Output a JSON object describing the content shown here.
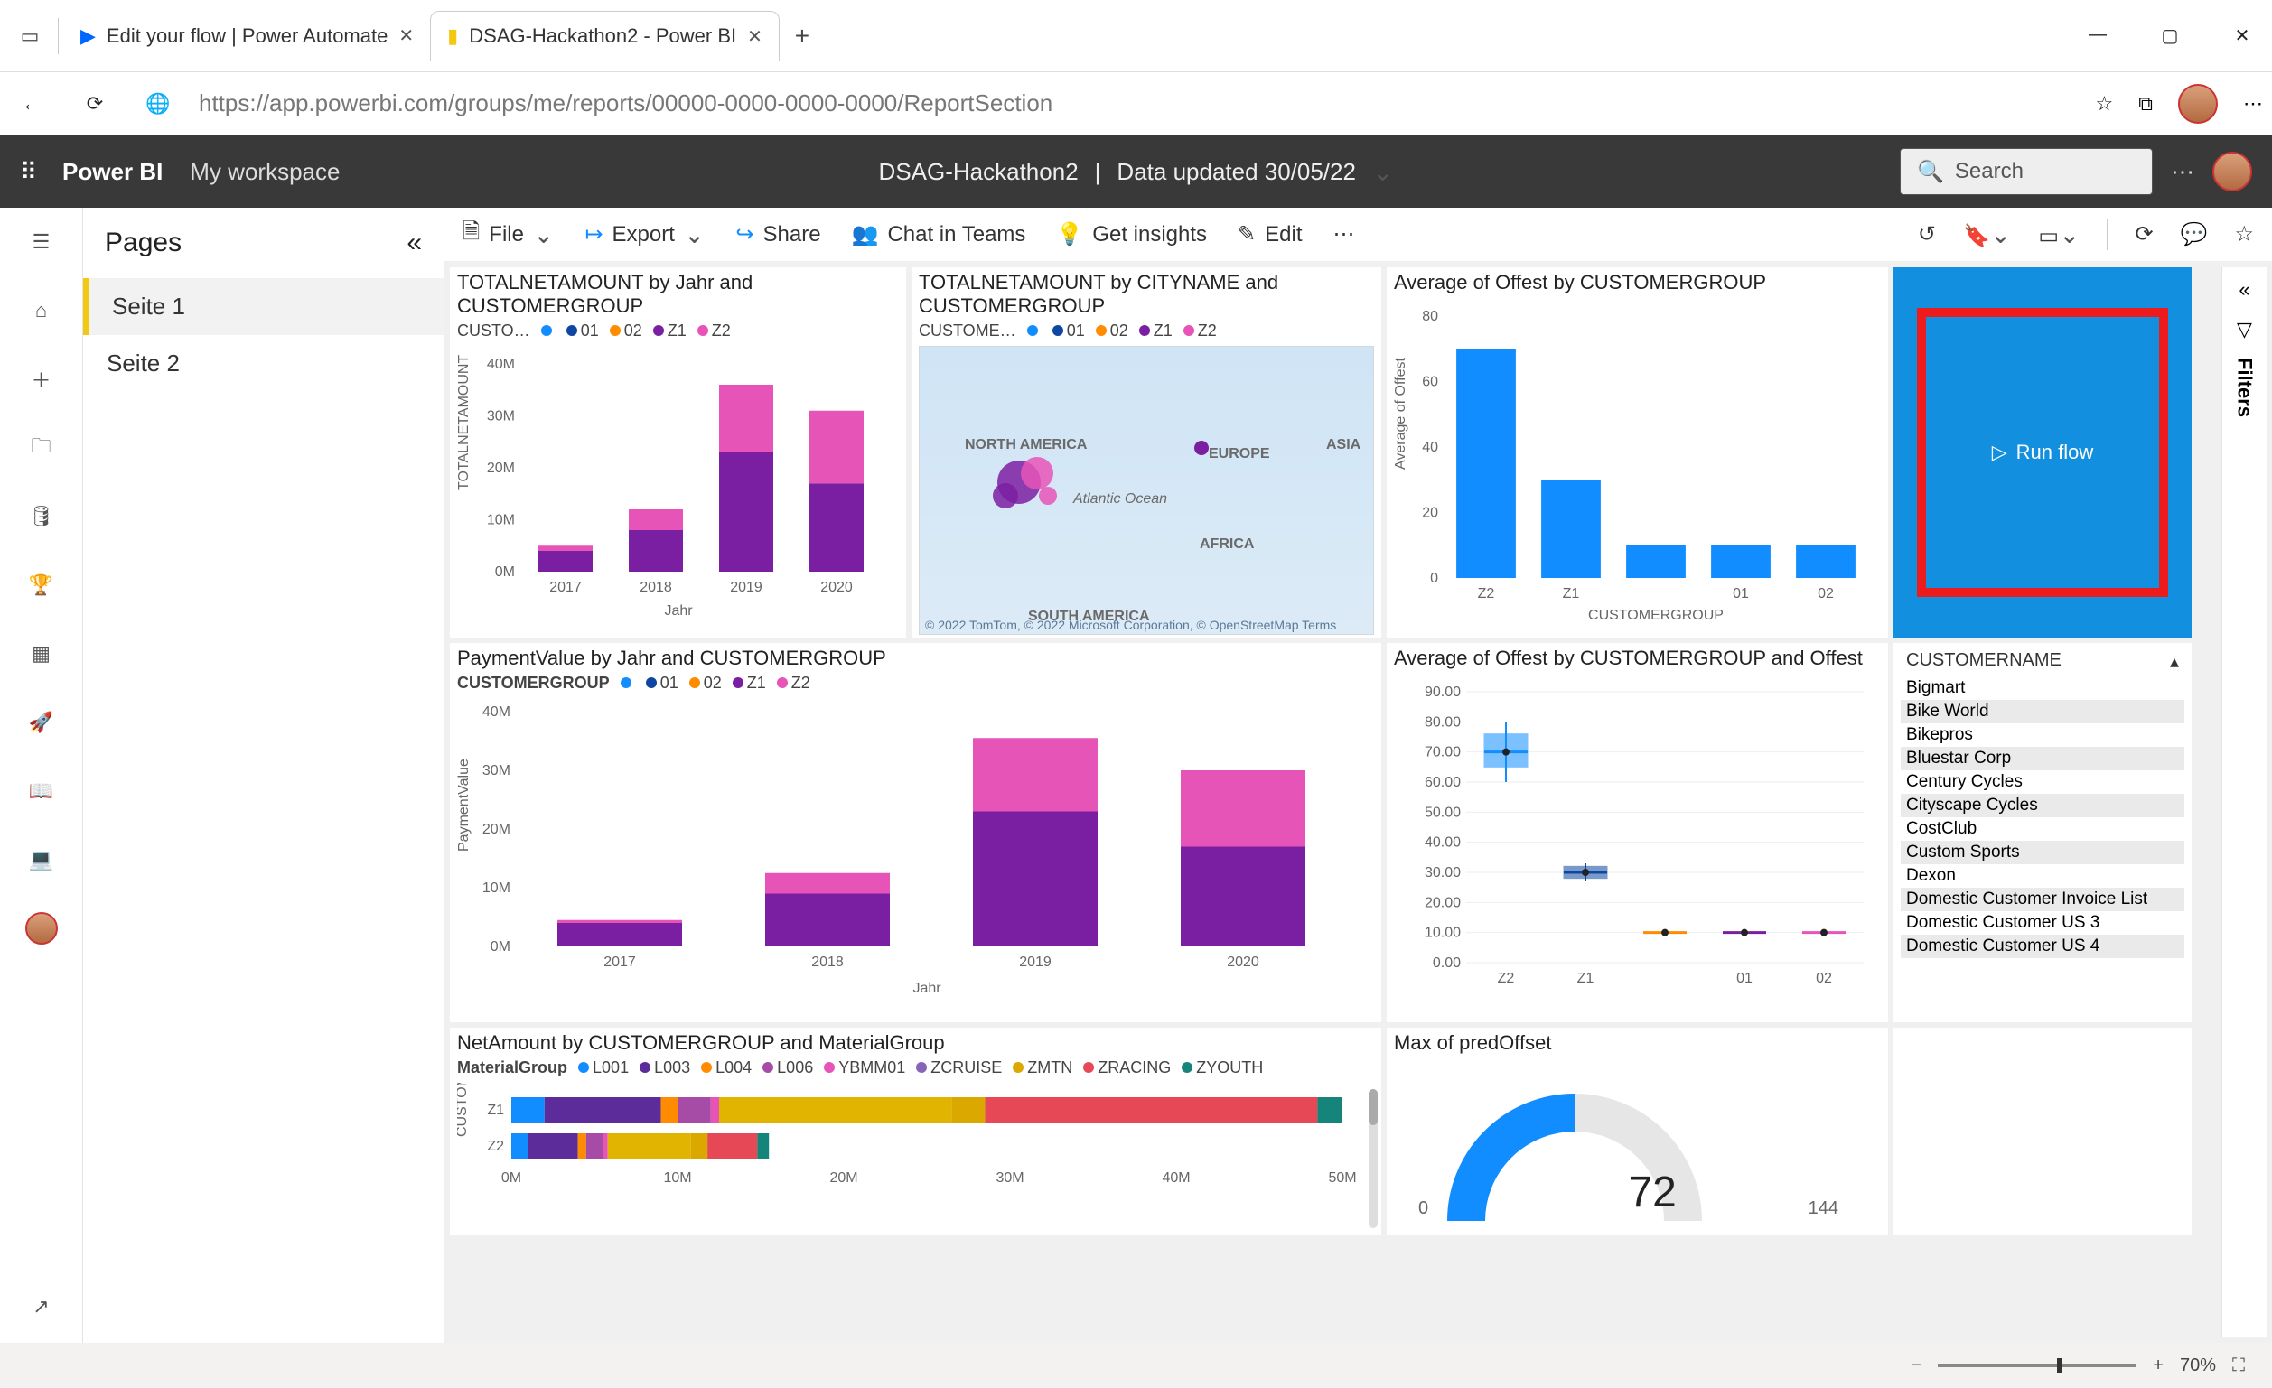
{
  "browser": {
    "tabs": [
      {
        "label": "Edit your flow | Power Automate",
        "icon": "power-automate-icon"
      },
      {
        "label": "DSAG-Hackathon2 - Power BI",
        "icon": "power-bi-icon"
      }
    ],
    "url_display": "https://app.powerbi.com/groups/me/reports/00000-0000-0000-0000/ReportSection",
    "url_host": "app.powerbi.com"
  },
  "pbi": {
    "product": "Power BI",
    "workspace": "My workspace",
    "report_name": "DSAG-Hackathon2",
    "data_updated": "Data updated 30/05/22",
    "search_placeholder": "Search"
  },
  "pages": {
    "title": "Pages",
    "items": [
      {
        "label": "Seite 1",
        "active": true
      },
      {
        "label": "Seite 2",
        "active": false
      }
    ]
  },
  "toolbar": {
    "file": "File",
    "export": "Export",
    "share": "Share",
    "chat": "Chat in Teams",
    "insights": "Get insights",
    "edit": "Edit"
  },
  "run_flow": {
    "label": "Run flow"
  },
  "customers": {
    "header": "CUSTOMERNAME",
    "rows": [
      "Bigmart",
      "Bike World",
      "Bikepros",
      "Bluestar Corp",
      "Century Cycles",
      "Cityscape Cycles",
      "CostClub",
      "Custom Sports",
      "Dexon",
      "Domestic Customer Invoice List",
      "Domestic Customer US 3",
      "Domestic Customer US 4"
    ]
  },
  "gauge": {
    "title": "Max of predOffset",
    "value": "72",
    "min": "0",
    "max": "144"
  },
  "zoom": {
    "minus": "−",
    "plus": "+",
    "pct": "70%"
  },
  "filters_label": "Filters",
  "chart_data": [
    {
      "id": "totalnetamount_year",
      "type": "bar_stacked",
      "title": "TOTALNETAMOUNT by Jahr and CUSTOMERGROUP",
      "xlabel": "Jahr",
      "ylabel": "TOTALNETAMOUNT",
      "legend_label": "CUSTO…",
      "ylim": [
        0,
        40000000
      ],
      "yticks": [
        "0M",
        "10M",
        "20M",
        "30M",
        "40M"
      ],
      "categories": [
        "2017",
        "2018",
        "2019",
        "2020"
      ],
      "series": [
        {
          "name": "Z1",
          "color": "#7b1fa2",
          "values": [
            4000000,
            8000000,
            23000000,
            17000000
          ]
        },
        {
          "name": "Z2",
          "color": "#e754b8",
          "values": [
            1000000,
            4000000,
            13000000,
            14000000
          ]
        }
      ],
      "legend_items": [
        {
          "name": "",
          "color": "#118dff"
        },
        {
          "name": "01",
          "color": "#0d47a1"
        },
        {
          "name": "02",
          "color": "#ff8c00"
        },
        {
          "name": "Z1",
          "color": "#7b1fa2"
        },
        {
          "name": "Z2",
          "color": "#e754b8"
        }
      ]
    },
    {
      "id": "totalnetamount_city",
      "type": "map",
      "title": "TOTALNETAMOUNT by CITYNAME and CUSTOMERGROUP",
      "legend_label": "CUSTOME…",
      "legend_items": [
        {
          "name": "",
          "color": "#118dff"
        },
        {
          "name": "01",
          "color": "#0d47a1"
        },
        {
          "name": "02",
          "color": "#ff8c00"
        },
        {
          "name": "Z1",
          "color": "#7b1fa2"
        },
        {
          "name": "Z2",
          "color": "#e754b8"
        }
      ],
      "map_attrib": "© 2022 TomTom, © 2022 Microsoft Corporation,  © OpenStreetMap Terms",
      "map_labels": [
        "NORTH AMERICA",
        "EUROPE",
        "ASIA",
        "Atlantic Ocean",
        "AFRICA",
        "SOUTH AMERICA"
      ]
    },
    {
      "id": "avg_offest_group",
      "type": "bar",
      "title": "Average of Offest by CUSTOMERGROUP",
      "xlabel": "CUSTOMERGROUP",
      "ylabel": "Average of Offest",
      "ylim": [
        0,
        80
      ],
      "yticks": [
        "0",
        "20",
        "40",
        "60",
        "80"
      ],
      "categories": [
        "Z2",
        "Z1",
        "",
        "01",
        "02"
      ],
      "series": [
        {
          "name": "Offest",
          "color": "#118dff",
          "values": [
            70,
            30,
            10,
            10,
            10
          ]
        }
      ]
    },
    {
      "id": "paymentvalue_year",
      "type": "bar_stacked",
      "title": "PaymentValue by Jahr and CUSTOMERGROUP",
      "xlabel": "Jahr",
      "ylabel": "PaymentValue",
      "legend_label": "CUSTOMERGROUP",
      "ylim": [
        0,
        40000000
      ],
      "yticks": [
        "0M",
        "10M",
        "20M",
        "30M",
        "40M"
      ],
      "categories": [
        "2017",
        "2018",
        "2019",
        "2020"
      ],
      "series": [
        {
          "name": "Z1",
          "color": "#7b1fa2",
          "values": [
            4000000,
            9000000,
            23000000,
            17000000
          ]
        },
        {
          "name": "Z2",
          "color": "#e754b8",
          "values": [
            500000,
            3500000,
            12500000,
            13000000
          ]
        }
      ],
      "legend_items": [
        {
          "name": "",
          "color": "#118dff"
        },
        {
          "name": "01",
          "color": "#0d47a1"
        },
        {
          "name": "02",
          "color": "#ff8c00"
        },
        {
          "name": "Z1",
          "color": "#7b1fa2"
        },
        {
          "name": "Z2",
          "color": "#e754b8"
        }
      ]
    },
    {
      "id": "avg_offest_box",
      "type": "box",
      "title": "Average of Offest by CUSTOMERGROUP and Offest",
      "ylim": [
        0,
        90
      ],
      "yticks": [
        "0.00",
        "10.00",
        "20.00",
        "30.00",
        "40.00",
        "50.00",
        "60.00",
        "70.00",
        "80.00",
        "90.00"
      ],
      "categories": [
        "Z2",
        "Z1",
        "",
        "01",
        "02"
      ],
      "boxes": [
        {
          "cat": "Z2",
          "min": 60,
          "q1": 65,
          "median": 70,
          "q3": 76,
          "max": 80,
          "color": "#118dff"
        },
        {
          "cat": "Z1",
          "min": 27,
          "q1": 28,
          "median": 30,
          "q3": 32,
          "max": 33,
          "color": "#0d47a1"
        },
        {
          "cat": "",
          "min": 10,
          "q1": 10,
          "median": 10,
          "q3": 10,
          "max": 10,
          "color": "#ff8c00"
        },
        {
          "cat": "01",
          "min": 10,
          "q1": 10,
          "median": 10,
          "q3": 10,
          "max": 10,
          "color": "#7b1fa2"
        },
        {
          "cat": "02",
          "min": 10,
          "q1": 10,
          "median": 10,
          "q3": 10,
          "max": 10,
          "color": "#e754b8"
        }
      ]
    },
    {
      "id": "netamount_material",
      "type": "bar_stacked_horizontal",
      "title": "NetAmount by CUSTOMERGROUP and MaterialGroup",
      "xlabel": "",
      "ylabel": "CUSTOMER…",
      "xlim": [
        0,
        50000000
      ],
      "xticks": [
        "0M",
        "10M",
        "20M",
        "30M",
        "40M",
        "50M"
      ],
      "categories": [
        "Z1",
        "Z2"
      ],
      "legend_label": "MaterialGroup",
      "series": [
        {
          "name": "L001",
          "color": "#118dff",
          "values": [
            2000000,
            1000000
          ]
        },
        {
          "name": "L003",
          "color": "#5b2c9a",
          "values": [
            7000000,
            3000000
          ]
        },
        {
          "name": "L004",
          "color": "#ff8c00",
          "values": [
            1000000,
            500000
          ]
        },
        {
          "name": "L006",
          "color": "#a64ca6",
          "values": [
            2000000,
            1000000
          ]
        },
        {
          "name": "YBMM01",
          "color": "#e754b8",
          "values": [
            500000,
            300000
          ]
        },
        {
          "name": "ZCRUISE",
          "color": "#e0b400",
          "values": [
            14000000,
            5000000
          ]
        },
        {
          "name": "ZMTN",
          "color": "#dba800",
          "values": [
            2000000,
            1000000
          ]
        },
        {
          "name": "ZRACING",
          "color": "#e74856",
          "values": [
            20000000,
            3000000
          ]
        },
        {
          "name": "ZYOUTH",
          "color": "#15857b",
          "values": [
            1500000,
            700000
          ]
        }
      ]
    }
  ]
}
